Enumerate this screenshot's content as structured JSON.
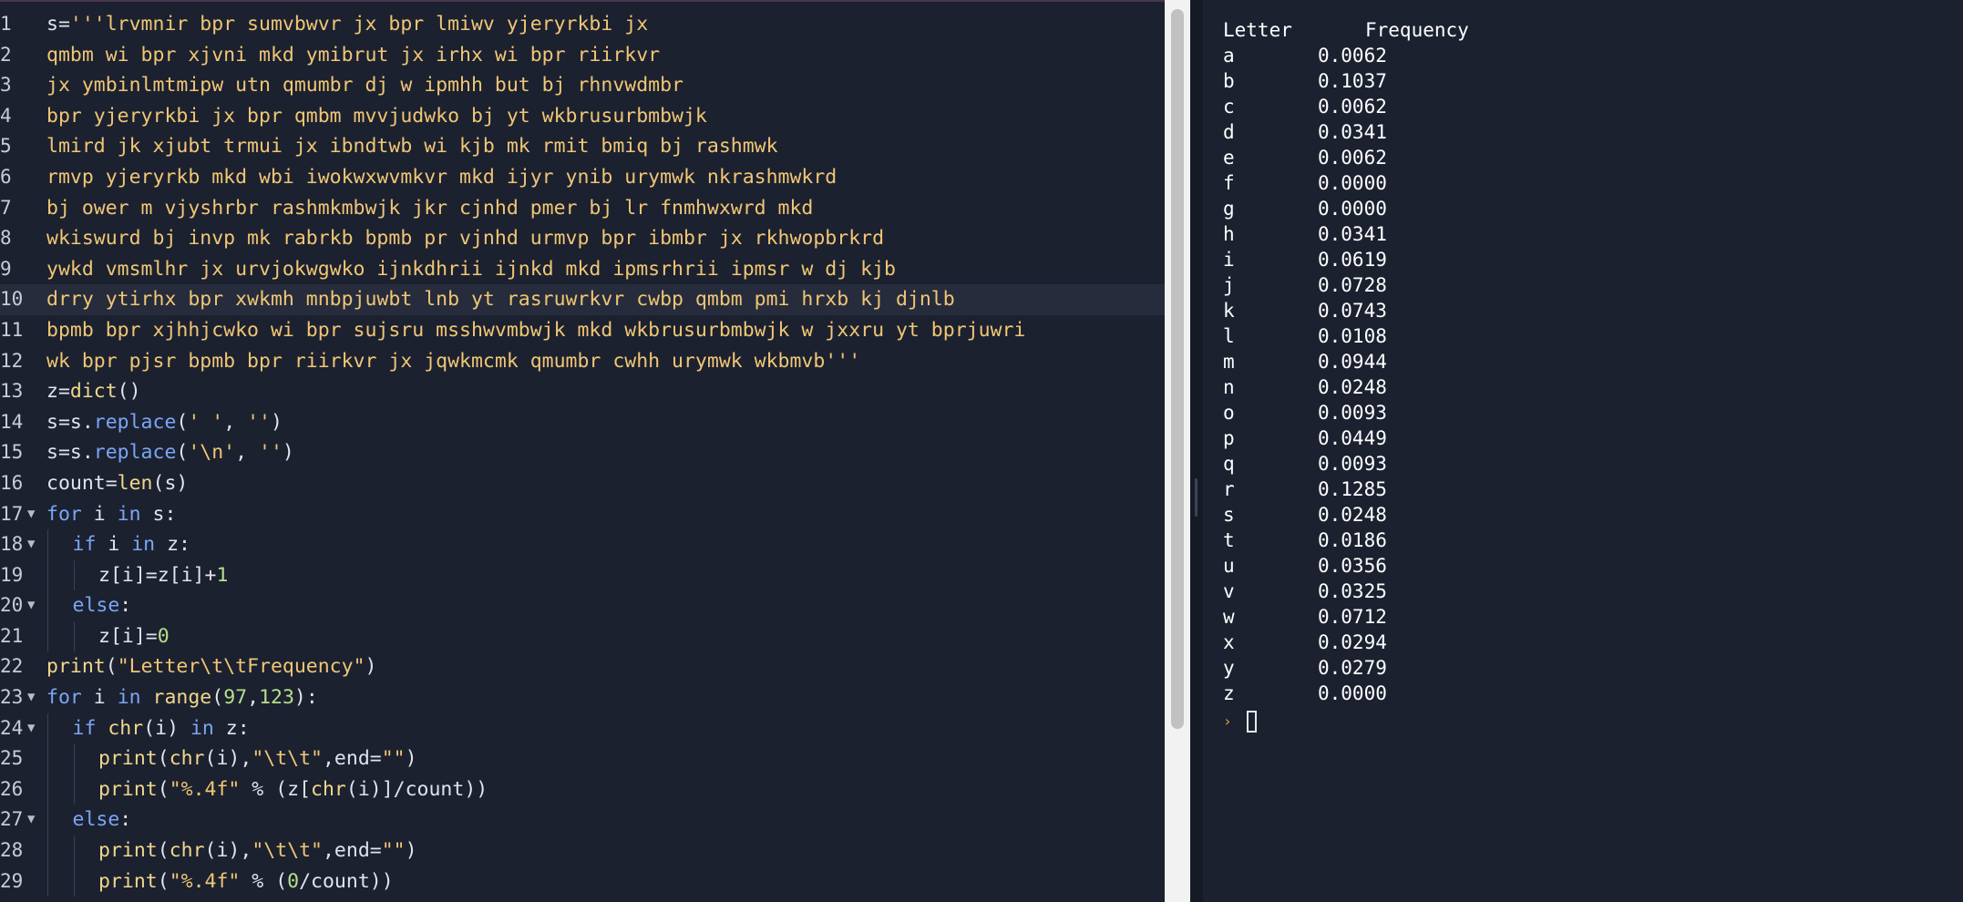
{
  "editor": {
    "active_line": 10,
    "lines": [
      {
        "n": "1",
        "fold": false,
        "indent": 0,
        "segs": [
          {
            "t": "pl",
            "v": "s="
          },
          {
            "t": "str",
            "v": "'''lrvmnir bpr sumvbwvr jx bpr lmiwv yjeryrkbi jx"
          }
        ]
      },
      {
        "n": "2",
        "fold": false,
        "indent": 0,
        "segs": [
          {
            "t": "str",
            "v": "qmbm wi bpr xjvni mkd ymibrut jx irhx wi bpr riirkvr"
          }
        ]
      },
      {
        "n": "3",
        "fold": false,
        "indent": 0,
        "segs": [
          {
            "t": "str",
            "v": "jx ymbinlmtmipw utn qmumbr dj w ipmhh but bj rhnvwdmbr"
          }
        ]
      },
      {
        "n": "4",
        "fold": false,
        "indent": 0,
        "segs": [
          {
            "t": "str",
            "v": "bpr yjeryrkbi jx bpr qmbm mvvjudwko bj yt wkbrusurbmbwjk"
          }
        ]
      },
      {
        "n": "5",
        "fold": false,
        "indent": 0,
        "segs": [
          {
            "t": "str",
            "v": "lmird jk xjubt trmui jx ibndtwb wi kjb mk rmit bmiq bj rashmwk"
          }
        ]
      },
      {
        "n": "6",
        "fold": false,
        "indent": 0,
        "segs": [
          {
            "t": "str",
            "v": "rmvp yjeryrkb mkd wbi iwokwxwvmkvr mkd ijyr ynib urymwk nkrashmwkrd"
          }
        ]
      },
      {
        "n": "7",
        "fold": false,
        "indent": 0,
        "segs": [
          {
            "t": "str",
            "v": "bj ower m vjyshrbr rashmkmbwjk jkr cjnhd pmer bj lr fnmhwxwrd mkd"
          }
        ]
      },
      {
        "n": "8",
        "fold": false,
        "indent": 0,
        "segs": [
          {
            "t": "str",
            "v": "wkiswurd bj invp mk rabrkb bpmb pr vjnhd urmvp bpr ibmbr jx rkhwopbrkrd"
          }
        ]
      },
      {
        "n": "9",
        "fold": false,
        "indent": 0,
        "segs": [
          {
            "t": "str",
            "v": "ywkd vmsmlhr jx urvjokwgwko ijnkdhrii ijnkd mkd ipmsrhrii ipmsr w dj kjb"
          }
        ]
      },
      {
        "n": "10",
        "fold": false,
        "indent": 0,
        "segs": [
          {
            "t": "str",
            "v": "drry ytirhx bpr xwkmh mnbpjuwbt lnb yt rasruwrkvr cwbp qmbm pmi hrxb kj djnlb"
          }
        ]
      },
      {
        "n": "11",
        "fold": false,
        "indent": 0,
        "segs": [
          {
            "t": "str",
            "v": "bpmb bpr xjhhjcwko wi bpr sujsru msshwvmbwjk mkd wkbrusurbmbwjk w jxxru yt bprjuwri"
          }
        ]
      },
      {
        "n": "12",
        "fold": false,
        "indent": 0,
        "segs": [
          {
            "t": "str",
            "v": "wk bpr pjsr bpmb bpr riirkvr jx jqwkmcmk qmumbr cwhh urymwk wkbmvb'''"
          }
        ]
      },
      {
        "n": "13",
        "fold": false,
        "indent": 0,
        "segs": [
          {
            "t": "pl",
            "v": "z="
          },
          {
            "t": "fn",
            "v": "dict"
          },
          {
            "t": "pl",
            "v": "()"
          }
        ]
      },
      {
        "n": "14",
        "fold": false,
        "indent": 0,
        "segs": [
          {
            "t": "pl",
            "v": "s=s."
          },
          {
            "t": "kw",
            "v": "replace"
          },
          {
            "t": "pl",
            "v": "("
          },
          {
            "t": "str",
            "v": "' '"
          },
          {
            "t": "pl",
            "v": ", "
          },
          {
            "t": "str",
            "v": "''"
          },
          {
            "t": "pl",
            "v": ")"
          }
        ]
      },
      {
        "n": "15",
        "fold": false,
        "indent": 0,
        "segs": [
          {
            "t": "pl",
            "v": "s=s."
          },
          {
            "t": "kw",
            "v": "replace"
          },
          {
            "t": "pl",
            "v": "("
          },
          {
            "t": "str",
            "v": "'\\n'"
          },
          {
            "t": "pl",
            "v": ", "
          },
          {
            "t": "str",
            "v": "''"
          },
          {
            "t": "pl",
            "v": ")"
          }
        ]
      },
      {
        "n": "16",
        "fold": false,
        "indent": 0,
        "segs": [
          {
            "t": "pl",
            "v": "count="
          },
          {
            "t": "fn",
            "v": "len"
          },
          {
            "t": "pl",
            "v": "(s)"
          }
        ]
      },
      {
        "n": "17",
        "fold": true,
        "indent": 0,
        "segs": [
          {
            "t": "kw",
            "v": "for"
          },
          {
            "t": "pl",
            "v": " i "
          },
          {
            "t": "kw",
            "v": "in"
          },
          {
            "t": "pl",
            "v": " s:"
          }
        ]
      },
      {
        "n": "18",
        "fold": true,
        "indent": 1,
        "segs": [
          {
            "t": "kw",
            "v": "if"
          },
          {
            "t": "pl",
            "v": " i "
          },
          {
            "t": "kw",
            "v": "in"
          },
          {
            "t": "pl",
            "v": " z:"
          }
        ]
      },
      {
        "n": "19",
        "fold": false,
        "indent": 2,
        "segs": [
          {
            "t": "pl",
            "v": "z[i]=z[i]"
          },
          {
            "t": "op",
            "v": "+"
          },
          {
            "t": "num",
            "v": "1"
          }
        ]
      },
      {
        "n": "20",
        "fold": true,
        "indent": 1,
        "segs": [
          {
            "t": "kw",
            "v": "else"
          },
          {
            "t": "pl",
            "v": ":"
          }
        ]
      },
      {
        "n": "21",
        "fold": false,
        "indent": 2,
        "segs": [
          {
            "t": "pl",
            "v": "z[i]="
          },
          {
            "t": "num",
            "v": "0"
          }
        ]
      },
      {
        "n": "22",
        "fold": false,
        "indent": 0,
        "segs": [
          {
            "t": "fn",
            "v": "print"
          },
          {
            "t": "pl",
            "v": "("
          },
          {
            "t": "str",
            "v": "\"Letter\\t\\tFrequency\""
          },
          {
            "t": "pl",
            "v": ")"
          }
        ]
      },
      {
        "n": "23",
        "fold": true,
        "indent": 0,
        "segs": [
          {
            "t": "kw",
            "v": "for"
          },
          {
            "t": "pl",
            "v": " i "
          },
          {
            "t": "kw",
            "v": "in"
          },
          {
            "t": "pl",
            "v": " "
          },
          {
            "t": "fn",
            "v": "range"
          },
          {
            "t": "pl",
            "v": "("
          },
          {
            "t": "num",
            "v": "97"
          },
          {
            "t": "pl",
            "v": ","
          },
          {
            "t": "num",
            "v": "123"
          },
          {
            "t": "pl",
            "v": "):"
          }
        ]
      },
      {
        "n": "24",
        "fold": true,
        "indent": 1,
        "segs": [
          {
            "t": "kw",
            "v": "if"
          },
          {
            "t": "pl",
            "v": " "
          },
          {
            "t": "fn",
            "v": "chr"
          },
          {
            "t": "pl",
            "v": "(i) "
          },
          {
            "t": "kw",
            "v": "in"
          },
          {
            "t": "pl",
            "v": " z:"
          }
        ]
      },
      {
        "n": "25",
        "fold": false,
        "indent": 2,
        "segs": [
          {
            "t": "fn",
            "v": "print"
          },
          {
            "t": "pl",
            "v": "("
          },
          {
            "t": "fn",
            "v": "chr"
          },
          {
            "t": "pl",
            "v": "(i),"
          },
          {
            "t": "str",
            "v": "\"\\t\\t\""
          },
          {
            "t": "pl",
            "v": ",end="
          },
          {
            "t": "str",
            "v": "\"\""
          },
          {
            "t": "pl",
            "v": ")"
          }
        ]
      },
      {
        "n": "26",
        "fold": false,
        "indent": 2,
        "segs": [
          {
            "t": "fn",
            "v": "print"
          },
          {
            "t": "pl",
            "v": "("
          },
          {
            "t": "str",
            "v": "\"%.4f\""
          },
          {
            "t": "pl",
            "v": " % (z["
          },
          {
            "t": "fn",
            "v": "chr"
          },
          {
            "t": "pl",
            "v": "(i)]/count))"
          }
        ]
      },
      {
        "n": "27",
        "fold": true,
        "indent": 1,
        "segs": [
          {
            "t": "kw",
            "v": "else"
          },
          {
            "t": "pl",
            "v": ":"
          }
        ]
      },
      {
        "n": "28",
        "fold": false,
        "indent": 2,
        "segs": [
          {
            "t": "fn",
            "v": "print"
          },
          {
            "t": "pl",
            "v": "("
          },
          {
            "t": "fn",
            "v": "chr"
          },
          {
            "t": "pl",
            "v": "(i),"
          },
          {
            "t": "str",
            "v": "\"\\t\\t\""
          },
          {
            "t": "pl",
            "v": ",end="
          },
          {
            "t": "str",
            "v": "\"\""
          },
          {
            "t": "pl",
            "v": ")"
          }
        ]
      },
      {
        "n": "29",
        "fold": false,
        "indent": 2,
        "segs": [
          {
            "t": "fn",
            "v": "print"
          },
          {
            "t": "pl",
            "v": "("
          },
          {
            "t": "str",
            "v": "\"%.4f\""
          },
          {
            "t": "pl",
            "v": " % ("
          },
          {
            "t": "num",
            "v": "0"
          },
          {
            "t": "pl",
            "v": "/count))"
          }
        ]
      }
    ]
  },
  "console": {
    "header_letter": "Letter",
    "header_frequency": "Frequency",
    "rows": [
      {
        "letter": "a",
        "freq": "0.0062"
      },
      {
        "letter": "b",
        "freq": "0.1037"
      },
      {
        "letter": "c",
        "freq": "0.0062"
      },
      {
        "letter": "d",
        "freq": "0.0341"
      },
      {
        "letter": "e",
        "freq": "0.0062"
      },
      {
        "letter": "f",
        "freq": "0.0000"
      },
      {
        "letter": "g",
        "freq": "0.0000"
      },
      {
        "letter": "h",
        "freq": "0.0341"
      },
      {
        "letter": "i",
        "freq": "0.0619"
      },
      {
        "letter": "j",
        "freq": "0.0728"
      },
      {
        "letter": "k",
        "freq": "0.0743"
      },
      {
        "letter": "l",
        "freq": "0.0108"
      },
      {
        "letter": "m",
        "freq": "0.0944"
      },
      {
        "letter": "n",
        "freq": "0.0248"
      },
      {
        "letter": "o",
        "freq": "0.0093"
      },
      {
        "letter": "p",
        "freq": "0.0449"
      },
      {
        "letter": "q",
        "freq": "0.0093"
      },
      {
        "letter": "r",
        "freq": "0.1285"
      },
      {
        "letter": "s",
        "freq": "0.0248"
      },
      {
        "letter": "t",
        "freq": "0.0186"
      },
      {
        "letter": "u",
        "freq": "0.0356"
      },
      {
        "letter": "v",
        "freq": "0.0325"
      },
      {
        "letter": "w",
        "freq": "0.0712"
      },
      {
        "letter": "x",
        "freq": "0.0294"
      },
      {
        "letter": "y",
        "freq": "0.0279"
      },
      {
        "letter": "z",
        "freq": "0.0000"
      }
    ],
    "prompt_icon": "prompt-chevron-icon"
  },
  "colors": {
    "background": "#1c2130",
    "string": "#f0c674",
    "keyword": "#7aa6f5",
    "function": "#f0d78c",
    "number": "#b5e08a",
    "prompt": "#d4a72c"
  }
}
